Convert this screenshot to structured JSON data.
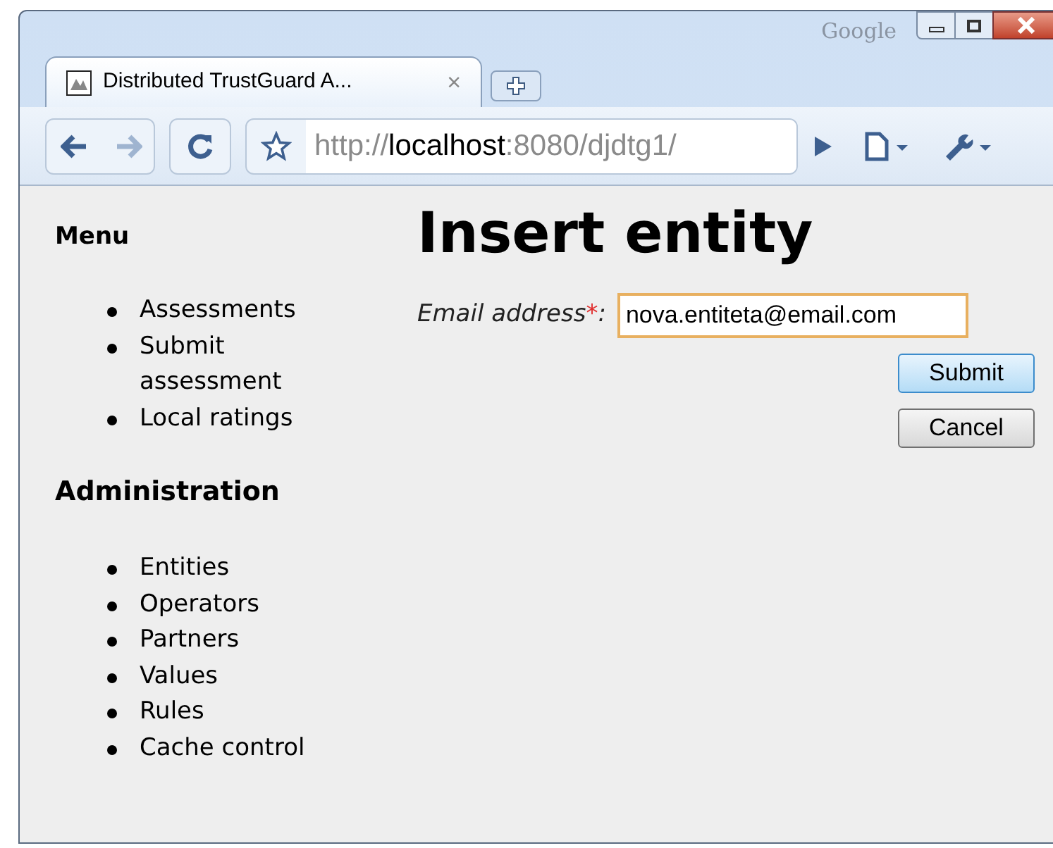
{
  "window": {
    "brand": "Google"
  },
  "tabs": [
    {
      "title": "Distributed TrustGuard A...",
      "close": "×",
      "selected": true
    }
  ],
  "toolbar": {
    "url": {
      "scheme": "http://",
      "host": "localhost",
      "rest": ":8080/djdtg1/"
    }
  },
  "sidebar": {
    "sections": [
      {
        "heading": "Menu",
        "items": [
          "Assessments",
          "Submit assessment",
          "Local ratings"
        ]
      },
      {
        "heading": "Administration",
        "items": [
          "Entities",
          "Operators",
          "Partners",
          "Values",
          "Rules",
          "Cache control"
        ]
      }
    ]
  },
  "main": {
    "heading": "Insert entity",
    "field": {
      "label": "Email address",
      "required_mark": "*",
      "colon": ":",
      "value": "nova.entiteta@email.com",
      "focused": true
    },
    "buttons": [
      {
        "label": "Submit",
        "primary": true
      },
      {
        "label": "Cancel",
        "primary": false
      }
    ]
  }
}
